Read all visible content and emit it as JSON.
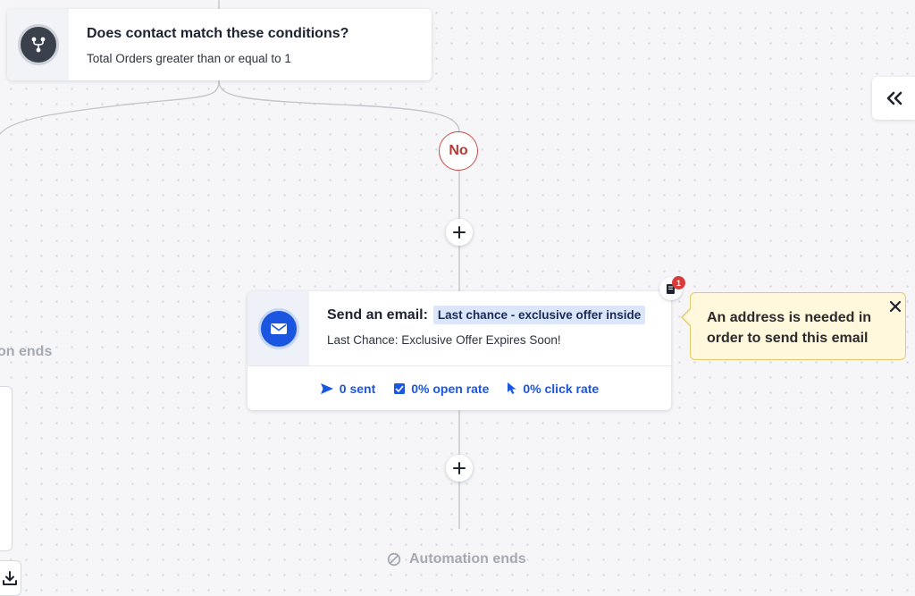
{
  "condition": {
    "title": "Does contact match these conditions?",
    "subtitle": "Total Orders greater than or equal to 1",
    "icon": "split-branch-icon"
  },
  "branch": {
    "no_label": "No"
  },
  "email_step": {
    "title": "Send an email:",
    "email_name": "Last chance - exclusive offer inside",
    "subject": "Last Chance: Exclusive Offer Expires Soon!",
    "icon": "envelope-icon",
    "stats": {
      "sent": "0 sent",
      "open_rate": "0% open rate",
      "click_rate": "0% click rate"
    }
  },
  "warning": {
    "count": "1",
    "message": "An address is needed in order to send this email"
  },
  "end": {
    "main_label": "Automation ends",
    "left_partial_label": "on ends"
  },
  "colors": {
    "accent_blue": "#1a56e0",
    "no_red": "#b53a35",
    "warning_bg": "#fff8dd",
    "warning_border": "#e4c969",
    "badge_red": "#d93b3b"
  }
}
